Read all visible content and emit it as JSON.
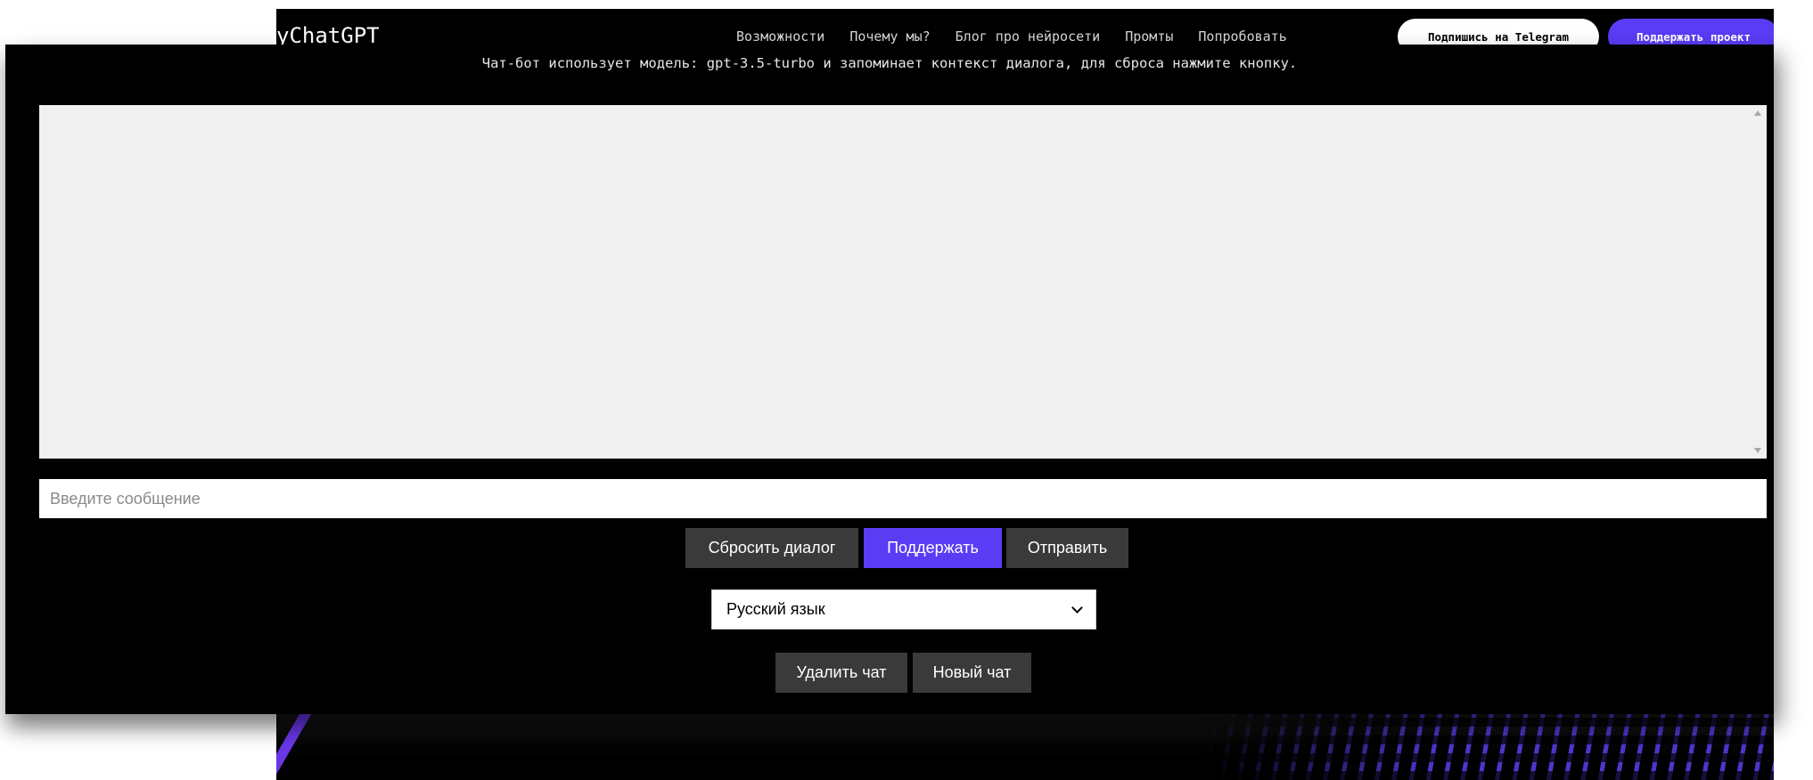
{
  "site": {
    "logo": "yChatGPT",
    "nav": [
      "Возможности",
      "Почему мы?",
      "Блог про нейросети",
      "Промты",
      "Попробовать"
    ],
    "telegram_button": "Подпишись на Telegram",
    "support_button": "Поддержать проект",
    "accent_color": "#5b3cf5"
  },
  "chat": {
    "model_info": "Чат-бот использует модель: gpt-3.5-turbo и запоминает контекст диалога, для сброса нажмите кнопку.",
    "input_placeholder": "Введите сообщение",
    "input_value": "",
    "buttons": {
      "reset": "Сбросить диалог",
      "donate": "Поддержать",
      "send": "Отправить",
      "delete_chat": "Удалить чат",
      "new_chat": "Новый чат"
    },
    "language_select": {
      "selected": "Русский язык"
    }
  }
}
